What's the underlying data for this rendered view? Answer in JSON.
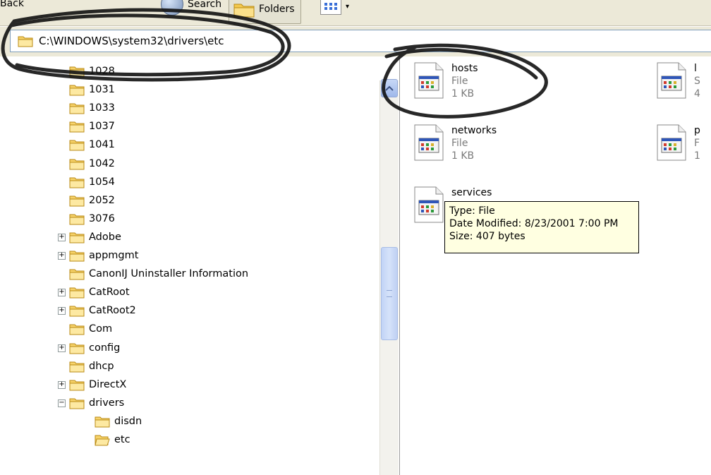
{
  "toolbar": {
    "back_label": "Back",
    "search_label": "Search",
    "folders_label": "Folders"
  },
  "address": {
    "path": "C:\\WINDOWS\\system32\\drivers\\etc"
  },
  "tree": {
    "items": [
      {
        "label": "1028",
        "expandable": false
      },
      {
        "label": "1031",
        "expandable": false
      },
      {
        "label": "1033",
        "expandable": false
      },
      {
        "label": "1037",
        "expandable": false
      },
      {
        "label": "1041",
        "expandable": false
      },
      {
        "label": "1042",
        "expandable": false
      },
      {
        "label": "1054",
        "expandable": false
      },
      {
        "label": "2052",
        "expandable": false
      },
      {
        "label": "3076",
        "expandable": false
      },
      {
        "label": "Adobe",
        "expandable": true
      },
      {
        "label": "appmgmt",
        "expandable": true
      },
      {
        "label": "CanonIJ Uninstaller Information",
        "expandable": false
      },
      {
        "label": "CatRoot",
        "expandable": true
      },
      {
        "label": "CatRoot2",
        "expandable": true
      },
      {
        "label": "Com",
        "expandable": false
      },
      {
        "label": "config",
        "expandable": true
      },
      {
        "label": "dhcp",
        "expandable": false
      },
      {
        "label": "DirectX",
        "expandable": true
      },
      {
        "label": "drivers",
        "expandable": true,
        "expanded": true
      },
      {
        "label": "disdn",
        "expandable": false,
        "child": true
      },
      {
        "label": "etc",
        "expandable": false,
        "child": true,
        "open": true
      }
    ]
  },
  "files": [
    {
      "name": "hosts",
      "type": "File",
      "size": "1 KB"
    },
    {
      "name": "networks",
      "type": "File",
      "size": "1 KB"
    },
    {
      "name": "services",
      "type": "",
      "size": ""
    },
    {
      "name": "l",
      "type": "S",
      "size": "4"
    },
    {
      "name": "p",
      "type": "F",
      "size": "1"
    }
  ],
  "tooltip": {
    "type": "Type: File",
    "modified": "Date Modified: 8/23/2001 7:00 PM",
    "size": "Size: 407 bytes"
  }
}
